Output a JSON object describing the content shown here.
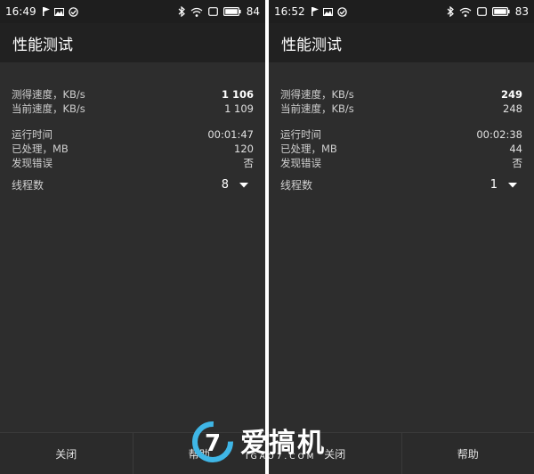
{
  "watermark": {
    "brand_cn": "爱搞机",
    "brand_en": "IGAO7.COM"
  },
  "colors": {
    "panel_bg": "#2d2d2d",
    "appbar_bg": "#212121",
    "statusbar_bg": "#1e1e1e"
  },
  "screens": [
    {
      "status": {
        "time": "16:49",
        "battery": "84",
        "left_icons": [
          "flag-icon",
          "image-icon",
          "check-circle-icon"
        ],
        "right_icons": [
          "bluetooth-icon",
          "wifi-icon",
          "sim-icon",
          "battery-icon"
        ]
      },
      "title": "性能测试",
      "rows1": [
        {
          "label": "测得速度，KB/s",
          "value": "1 106"
        },
        {
          "label": "当前速度，KB/s",
          "value": "1 109"
        }
      ],
      "rows2": [
        {
          "label": "运行时间",
          "value": "00:01:47"
        },
        {
          "label": "已处理，MB",
          "value": "120"
        },
        {
          "label": "发现错误",
          "value": "否"
        }
      ],
      "threads": {
        "label": "线程数",
        "value": "8"
      },
      "buttons": {
        "close": "关闭",
        "help": "帮助"
      }
    },
    {
      "status": {
        "time": "16:52",
        "battery": "83",
        "left_icons": [
          "flag-icon",
          "image-icon",
          "check-circle-icon"
        ],
        "right_icons": [
          "bluetooth-icon",
          "wifi-icon",
          "sim-icon",
          "battery-icon"
        ]
      },
      "title": "性能测试",
      "rows1": [
        {
          "label": "测得速度，KB/s",
          "value": "249"
        },
        {
          "label": "当前速度，KB/s",
          "value": "248"
        }
      ],
      "rows2": [
        {
          "label": "运行时间",
          "value": "00:02:38"
        },
        {
          "label": "已处理，MB",
          "value": "44"
        },
        {
          "label": "发现错误",
          "value": "否"
        }
      ],
      "threads": {
        "label": "线程数",
        "value": "1"
      },
      "buttons": {
        "close": "关闭",
        "help": "帮助"
      }
    }
  ]
}
